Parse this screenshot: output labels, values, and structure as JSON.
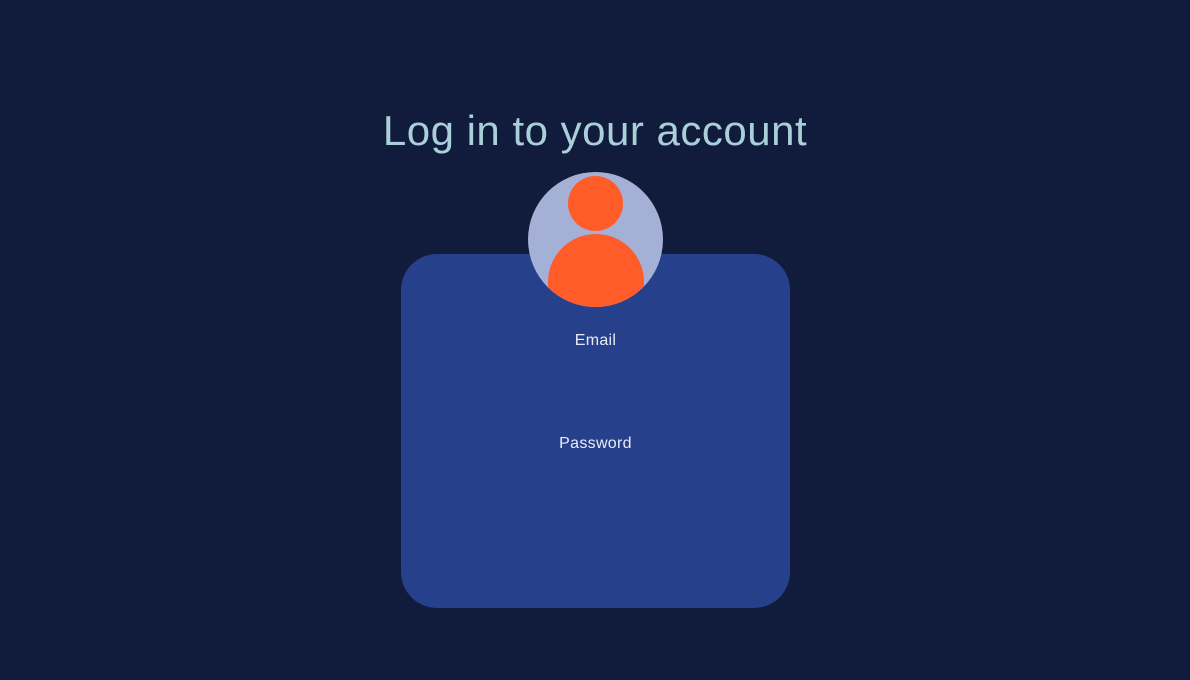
{
  "page": {
    "title": "Log in to your account",
    "background_color": "#111b3b",
    "title_color": "#a9cfd8"
  },
  "login_card": {
    "background_color": "#27408b",
    "email_label": "Email",
    "email_value": "",
    "password_label": "Password",
    "password_value": ""
  },
  "avatar": {
    "icon": "user-icon",
    "background_color": "#a5b0d7",
    "figure_color": "#ff5c29"
  }
}
